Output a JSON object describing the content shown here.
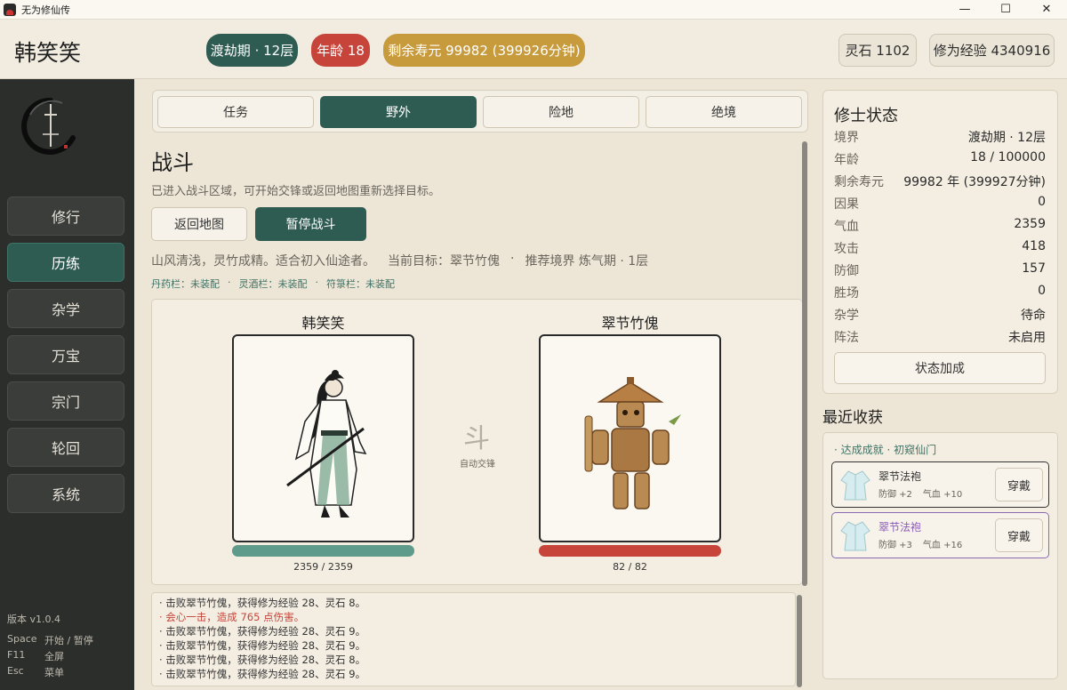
{
  "window": {
    "title": "无为修仙传",
    "minimize": "—",
    "maximize": "☐",
    "close": "✕"
  },
  "header": {
    "player_name": "韩笑笑",
    "realm": "渡劫期 · 12层",
    "age": "年龄 18",
    "lifespan": "剩余寿元 99982 (399926分钟)",
    "spirit_stones": "灵石 1102",
    "cultivation_exp": "修为经验 4340916"
  },
  "sidebar": {
    "items": [
      {
        "label": "修行"
      },
      {
        "label": "历练"
      },
      {
        "label": "杂学"
      },
      {
        "label": "万宝"
      },
      {
        "label": "宗门"
      },
      {
        "label": "轮回"
      },
      {
        "label": "系统"
      }
    ],
    "active_index": 1,
    "version": "版本 v1.0.4",
    "hotkeys": [
      {
        "key": "Space",
        "action": "开始 / 暂停"
      },
      {
        "key": "F11",
        "action": "全屏"
      },
      {
        "key": "Esc",
        "action": "菜单"
      }
    ]
  },
  "tabs": [
    {
      "label": "任务"
    },
    {
      "label": "野外"
    },
    {
      "label": "险地"
    },
    {
      "label": "绝境"
    }
  ],
  "active_tab": 1,
  "battle": {
    "title": "战斗",
    "description": "已进入战斗区域，可开始交锋或返回地图重新选择目标。",
    "back_button": "返回地图",
    "pause_button": "暂停战斗",
    "area_desc": "山风清浅，灵竹成精。适合初入仙途者。",
    "current_target": "当前目标：翠节竹傀",
    "recommended": "推荐境界 炼气期 · 1层",
    "separator": "·",
    "slots": {
      "pill": "丹药栏：未装配",
      "wine": "灵酒栏：未装配",
      "talisman": "符箓栏：未装配"
    },
    "player": {
      "name": "韩笑笑",
      "hp": "2359 / 2359",
      "hp_fraction": 1.0
    },
    "enemy": {
      "name": "翠节竹傀",
      "hp": "82 / 82",
      "hp_fraction": 1.0
    },
    "vs_char": "斗",
    "vs_label": "自动交锋",
    "log": [
      {
        "text": "· 击败翠节竹傀，获得修为经验 28、灵石 8。",
        "type": "normal"
      },
      {
        "text": "· 会心一击，造成 765 点伤害。",
        "type": "crit"
      },
      {
        "text": "· 击败翠节竹傀，获得修为经验 28、灵石 9。",
        "type": "normal"
      },
      {
        "text": "· 击败翠节竹傀，获得修为经验 28、灵石 9。",
        "type": "normal"
      },
      {
        "text": "· 击败翠节竹傀，获得修为经验 28、灵石 8。",
        "type": "normal"
      },
      {
        "text": "· 击败翠节竹傀，获得修为经验 28、灵石 9。",
        "type": "normal"
      }
    ]
  },
  "status": {
    "title": "修士状态",
    "rows": [
      {
        "key": "境界",
        "value": "渡劫期 · 12层"
      },
      {
        "key": "年龄",
        "value": "18 / 100000"
      },
      {
        "key": "剩余寿元",
        "value": "99982 年 (399927分钟)"
      },
      {
        "key": "因果",
        "value": "0"
      },
      {
        "key": "气血",
        "value": "2359"
      },
      {
        "key": "攻击",
        "value": "418"
      },
      {
        "key": "防御",
        "value": "157"
      },
      {
        "key": "胜场",
        "value": "0"
      },
      {
        "key": "杂学",
        "value": "待命"
      },
      {
        "key": "阵法",
        "value": "未启用"
      }
    ],
    "buff_button": "状态加成"
  },
  "loot": {
    "title": "最近收获",
    "achievement": "· 达成成就 · 初窥仙门",
    "items": [
      {
        "name": "翠节法袍",
        "def": "防御 +2",
        "hp": "气血 +10",
        "wear": "穿戴",
        "rarity": "common"
      },
      {
        "name": "翠节法袍",
        "def": "防御 +3",
        "hp": "气血 +16",
        "wear": "穿戴",
        "rarity": "rare"
      }
    ]
  },
  "colors": {
    "accent": "#2e5c52",
    "danger": "#c6443a",
    "gold": "#c79a3c",
    "sidebar": "#2b2e2b",
    "hp_player": "#5e9b8b",
    "hp_enemy": "#c6443a"
  }
}
